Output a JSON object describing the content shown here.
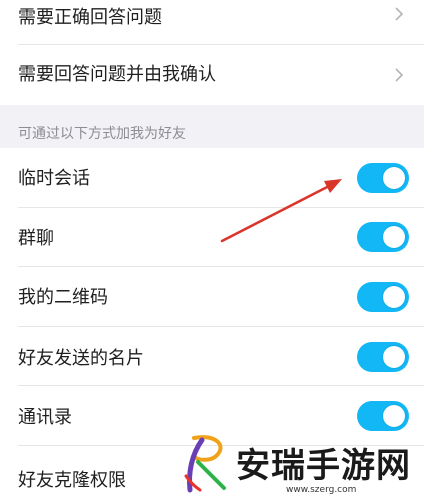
{
  "question_options": [
    {
      "label": "需要正确回答问题"
    },
    {
      "label": "需要回答问题并由我确认"
    }
  ],
  "section": {
    "header": "可通过以下方式加我为好友"
  },
  "friend_methods": [
    {
      "label": "临时会话",
      "enabled": true
    },
    {
      "label": "群聊",
      "enabled": true
    },
    {
      "label": "我的二维码",
      "enabled": true
    },
    {
      "label": "好友发送的名片",
      "enabled": true
    },
    {
      "label": "通讯录",
      "enabled": true
    },
    {
      "label": "好友克隆权限",
      "enabled": true
    }
  ],
  "colors": {
    "toggle_on": "#12b7f5",
    "section_bg": "#f2f2f6",
    "annotation_arrow": "#d9352b"
  },
  "icons": {
    "chevron": "chevron-right-icon"
  },
  "watermark": {
    "title": "安瑞手游网",
    "url": "www.szerg.com"
  }
}
